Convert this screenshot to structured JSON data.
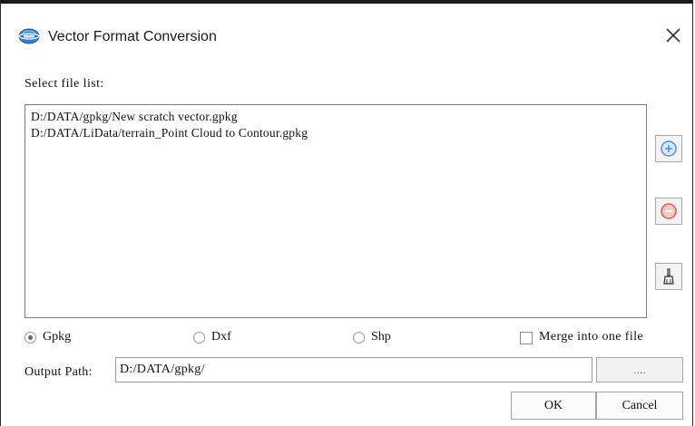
{
  "window": {
    "title": "Vector Format Conversion",
    "icon": "globe-app-icon",
    "close_icon": "close-icon"
  },
  "file_list": {
    "label": "Select file list:",
    "items": [
      "D:/DATA/gpkg/New scratch vector.gpkg",
      "D:/DATA/LiData/terrain_Point Cloud to Contour.gpkg"
    ]
  },
  "side_buttons": [
    {
      "name": "add-file-button",
      "icon": "plus-circle-icon",
      "color": "#4a90e2"
    },
    {
      "name": "remove-file-button",
      "icon": "minus-circle-icon",
      "color": "#e05a4f"
    },
    {
      "name": "clear-list-button",
      "icon": "broom-icon",
      "color": "#333333"
    }
  ],
  "format_options": {
    "selected": "Gpkg",
    "options": [
      "Gpkg",
      "Dxf",
      "Shp"
    ]
  },
  "merge_option": {
    "label": "Merge into one file",
    "checked": false
  },
  "output": {
    "label": "Output Path:",
    "value": "D:/DATA/gpkg/",
    "browse_label": "...."
  },
  "actions": {
    "ok_label": "OK",
    "cancel_label": "Cancel"
  }
}
